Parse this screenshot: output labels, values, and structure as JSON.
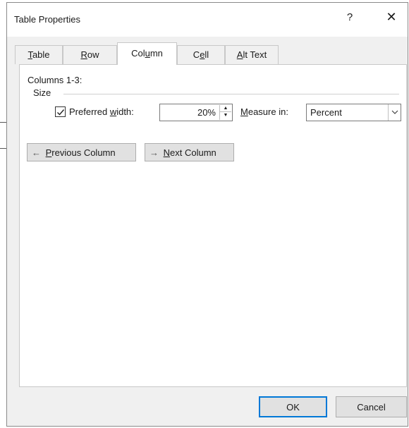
{
  "dialog": {
    "title": "Table Properties",
    "help_label": "?",
    "close_label": "✕"
  },
  "tabs": [
    {
      "pre": "",
      "key": "T",
      "post": "able"
    },
    {
      "pre": "",
      "key": "R",
      "post": "ow"
    },
    {
      "pre": "Col",
      "key": "u",
      "post": "mn"
    },
    {
      "pre": "C",
      "key": "e",
      "post": "ll"
    },
    {
      "pre": "",
      "key": "A",
      "post": "lt Text"
    }
  ],
  "active_tab": "Column",
  "column": {
    "columns_label": "Columns 1-3:",
    "size_label": "Size",
    "preferred_width": {
      "checked": true,
      "pre": "Preferred ",
      "key": "w",
      "post": "idth:"
    },
    "width_value": "20%",
    "measure_label": {
      "pre": "",
      "key": "M",
      "post": "easure in:"
    },
    "measure_value": "Percent",
    "prev_button": {
      "arrow": "←",
      "pre": "",
      "key": "P",
      "post": "revious Column"
    },
    "next_button": {
      "arrow": "→",
      "pre": "",
      "key": "N",
      "post": "ext Column"
    }
  },
  "footer": {
    "ok_label": "OK",
    "cancel_label": "Cancel"
  },
  "colors": {
    "dialog_bg": "#f0f0f0",
    "panel_bg": "#ffffff",
    "button_bg": "#e1e1e1",
    "focus_border": "#0078d7"
  }
}
